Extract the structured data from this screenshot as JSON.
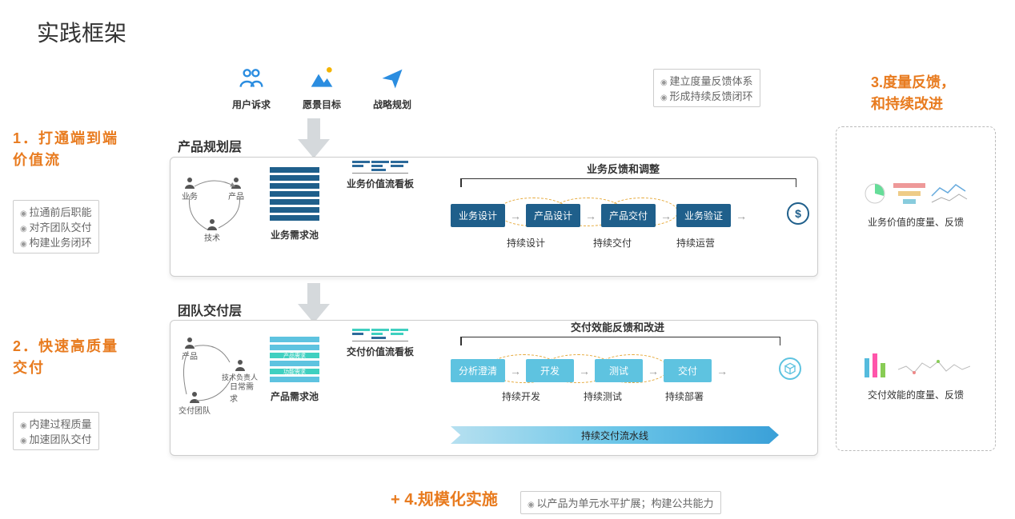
{
  "title": "实践框架",
  "top_icons": [
    {
      "label": "用户诉求",
      "name": "users-icon"
    },
    {
      "label": "愿景目标",
      "name": "mountain-icon"
    },
    {
      "label": "战略规划",
      "name": "plane-icon"
    }
  ],
  "sections": {
    "s1": {
      "num": "1．",
      "title": "打通端到端价值流"
    },
    "s2": {
      "num": "2．",
      "title": "快速高质量交付"
    },
    "s3": {
      "line1": "3.度量反馈，",
      "line2": "和持续改进"
    },
    "s4": "+  4.规模化实施"
  },
  "bullets": {
    "b1": [
      "拉通前后职能",
      "对齐团队交付",
      "构建业务闭环"
    ],
    "b2": [
      "内建过程质量",
      "加速团队交付"
    ],
    "b3": [
      "建立度量反馈体系",
      "形成持续反馈闭环"
    ],
    "b4": [
      "以产品为单元水平扩展；构建公共能力"
    ]
  },
  "layer1": {
    "layer_label": "产品规划层",
    "roles": [
      "业务",
      "产品",
      "技术"
    ],
    "pool_label": "业务需求池",
    "kanban_label": "业务价值流看板",
    "arc_label": "业务反馈和调整",
    "flow": [
      "业务设计",
      "产品设计",
      "产品交付",
      "业务验证"
    ],
    "subs": [
      "持续设计",
      "持续交付",
      "持续运营"
    ],
    "end_icon": "dollar-icon"
  },
  "layer2": {
    "layer_label": "团队交付层",
    "roles": [
      "产品",
      "技术负责人",
      "交付团队"
    ],
    "extra_role_note": "日常需求",
    "pool_label": "产品需求池",
    "pool_bars": [
      "产品需求",
      "功能需求"
    ],
    "kanban_label": "交付价值流看板",
    "arc_label": "交付效能反馈和改进",
    "flow": [
      "分析澄清",
      "开发",
      "测试",
      "交付"
    ],
    "subs": [
      "持续开发",
      "持续测试",
      "持续部署"
    ],
    "pipeline": "持续交付流水线",
    "end_icon": "cube-icon"
  },
  "measure": {
    "m1": "业务价值的度量、反馈",
    "m2": "交付效能的度量、反馈"
  }
}
